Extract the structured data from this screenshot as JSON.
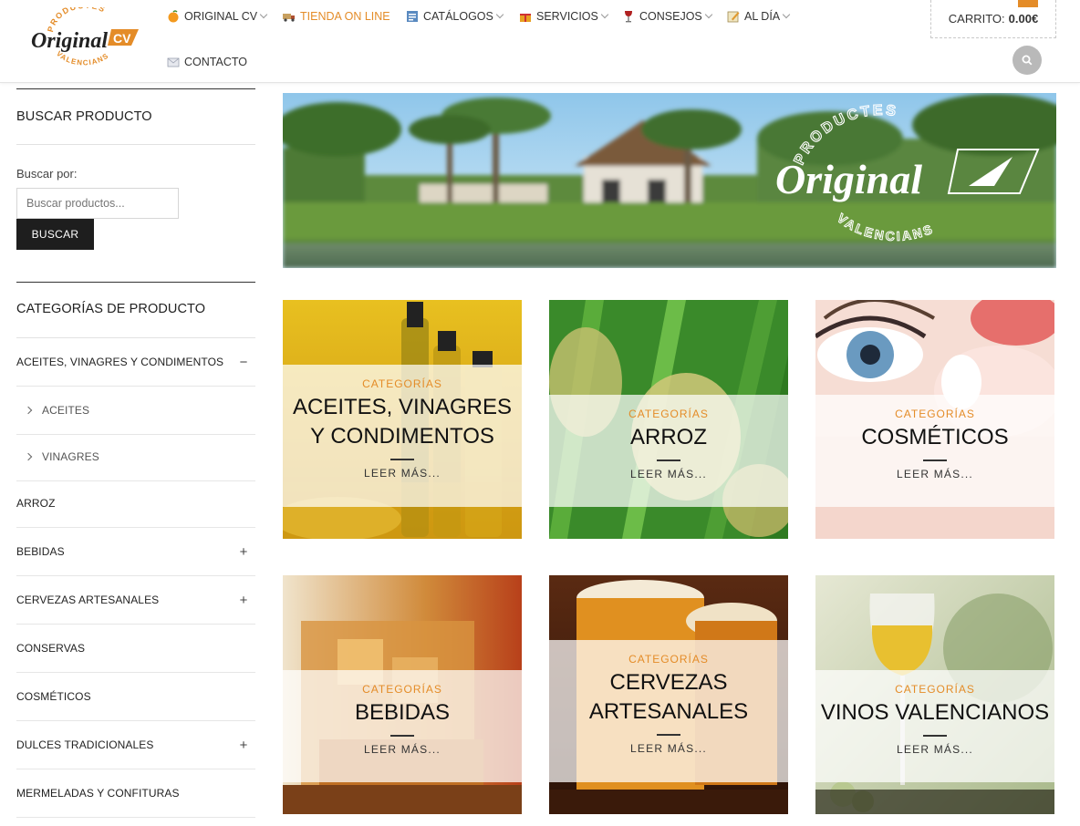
{
  "header": {
    "logo": {
      "top_text": "PRODUCTES",
      "main_text": "Original",
      "badge": "CV",
      "bottom_text": "VALENCIANS"
    },
    "nav": [
      {
        "label": "ORIGINAL CV",
        "icon": "orange-fruit-icon",
        "has_dropdown": true,
        "active": false
      },
      {
        "label": "TIENDA ON LINE",
        "icon": "truck-icon",
        "has_dropdown": false,
        "active": true
      },
      {
        "label": "CATÁLOGOS",
        "icon": "catalog-icon",
        "has_dropdown": true,
        "active": false
      },
      {
        "label": "SERVICIOS",
        "icon": "gift-icon",
        "has_dropdown": true,
        "active": false
      },
      {
        "label": "CONSEJOS",
        "icon": "wine-glass-icon",
        "has_dropdown": true,
        "active": false
      },
      {
        "label": "AL DÍA",
        "icon": "memo-icon",
        "has_dropdown": true,
        "active": false
      },
      {
        "label": "CONTACTO",
        "icon": "envelope-icon",
        "has_dropdown": false,
        "active": false
      }
    ],
    "cart": {
      "label": "CARRITO:",
      "amount": "0.00€"
    },
    "search_icon": "search-icon"
  },
  "sidebar": {
    "search": {
      "title": "BUSCAR PRODUCTO",
      "label": "Buscar por:",
      "placeholder": "Buscar productos...",
      "button": "BUSCAR"
    },
    "categories": {
      "title": "CATEGORÍAS DE PRODUCTO",
      "items": [
        {
          "label": "ACEITES, VINAGRES Y CONDIMENTOS",
          "toggle": "−",
          "sub": false
        },
        {
          "label": "ACEITES",
          "toggle": "",
          "sub": true
        },
        {
          "label": "VINAGRES",
          "toggle": "",
          "sub": true
        },
        {
          "label": "ARROZ",
          "toggle": "",
          "sub": false
        },
        {
          "label": "BEBIDAS",
          "toggle": "+",
          "sub": false
        },
        {
          "label": "CERVEZAS ARTESANALES",
          "toggle": "+",
          "sub": false
        },
        {
          "label": "CONSERVAS",
          "toggle": "",
          "sub": false
        },
        {
          "label": "COSMÉTICOS",
          "toggle": "",
          "sub": false
        },
        {
          "label": "DULCES TRADICIONALES",
          "toggle": "+",
          "sub": false
        },
        {
          "label": "MERMELADAS Y CONFITURAS",
          "toggle": "",
          "sub": false
        }
      ]
    }
  },
  "banner": {
    "logo_top": "PRODUCTES",
    "logo_main": "Original",
    "logo_badge": "CV",
    "logo_bottom": "VALENCIANS"
  },
  "tiles": [
    {
      "kicker": "CATEGORÍAS",
      "name": "ACEITES, VINAGRES Y CONDIMENTOS",
      "more": "LEER MÁS..."
    },
    {
      "kicker": "CATEGORÍAS",
      "name": "ARROZ",
      "more": "LEER MÁS..."
    },
    {
      "kicker": "CATEGORÍAS",
      "name": "COSMÉTICOS",
      "more": "LEER MÁS..."
    },
    {
      "kicker": "CATEGORÍAS",
      "name": "BEBIDAS",
      "more": "LEER MÁS..."
    },
    {
      "kicker": "CATEGORÍAS",
      "name": "CERVEZAS ARTESANALES",
      "more": "LEER MÁS..."
    },
    {
      "kicker": "CATEGORÍAS",
      "name": "VINOS VALENCIANOS",
      "more": "LEER MÁS..."
    }
  ],
  "colors": {
    "accent": "#e48c28",
    "dark": "#1e1e1e",
    "rule": "#333333"
  }
}
